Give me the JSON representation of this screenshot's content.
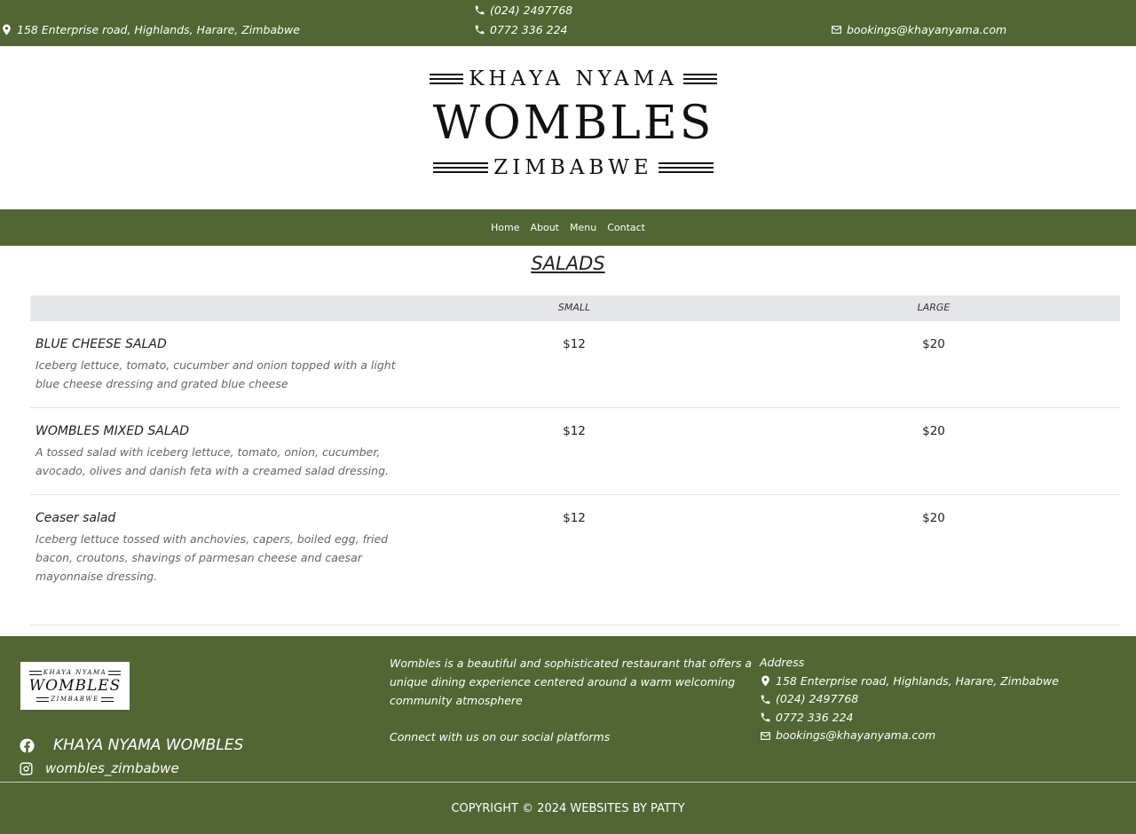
{
  "topbar": {
    "address": "158 Enterprise road, Highlands, Harare, Zimbabwe",
    "phone1": "(024) 2497768",
    "phone2": "0772 336 224",
    "email": "bookings@khayanyama.com"
  },
  "logo": {
    "top": "KHAYA NYAMA",
    "main": "WOMBLES",
    "bottom": "ZIMBABWE"
  },
  "nav": {
    "items": [
      "Home",
      "About",
      "Menu",
      "Contact"
    ]
  },
  "menu": {
    "title": "SALADS",
    "columns": {
      "small": "SMALL",
      "large": "LARGE"
    },
    "items": [
      {
        "name": "BLUE CHEESE SALAD",
        "description": "Iceberg lettuce, tomato, cucumber and onion topped with a light blue cheese dressing and grated blue cheese",
        "small": "$12",
        "large": "$20"
      },
      {
        "name": "WOMBLES MIXED SALAD",
        "description": "A tossed salad with iceberg lettuce, tomato, onion, cucumber, avocado, olives and danish feta with a creamed salad dressing.",
        "small": "$12",
        "large": "$20"
      },
      {
        "name": "Ceaser salad",
        "description": "Iceberg lettuce tossed with anchovies, capers, boiled egg, fried bacon, croutons, shavings of parmesan cheese and caesar mayonnaise dressing.",
        "small": "$12",
        "large": "$20"
      }
    ]
  },
  "footer": {
    "logo": {
      "top": "KHAYA NYAMA",
      "main": "WOMBLES",
      "bottom": "ZIMBABWE"
    },
    "facebook": "KHAYA NYAMA WOMBLES",
    "instagram": "wombles_zimbabwe",
    "about": "Wombles is a beautiful and sophisticated restaurant that offers a unique dining experience centered around a warm welcoming community atmosphere",
    "connect": "Connect with us on our social platforms",
    "address_heading": "Address",
    "address": "158 Enterprise road, Highlands, Harare, Zimbabwe",
    "phone1": "(024) 2497768",
    "phone2": "0772 336 224",
    "email": "bookings@khayanyama.com",
    "copyright": "COPYRIGHT © 2024 WEBSITES BY PATTY"
  },
  "colors": {
    "brand_green": "#516633",
    "header_row": "#e5e6e9"
  },
  "icons": [
    "map-marker-icon",
    "phone-icon",
    "envelope-icon",
    "facebook-icon",
    "instagram-icon"
  ]
}
